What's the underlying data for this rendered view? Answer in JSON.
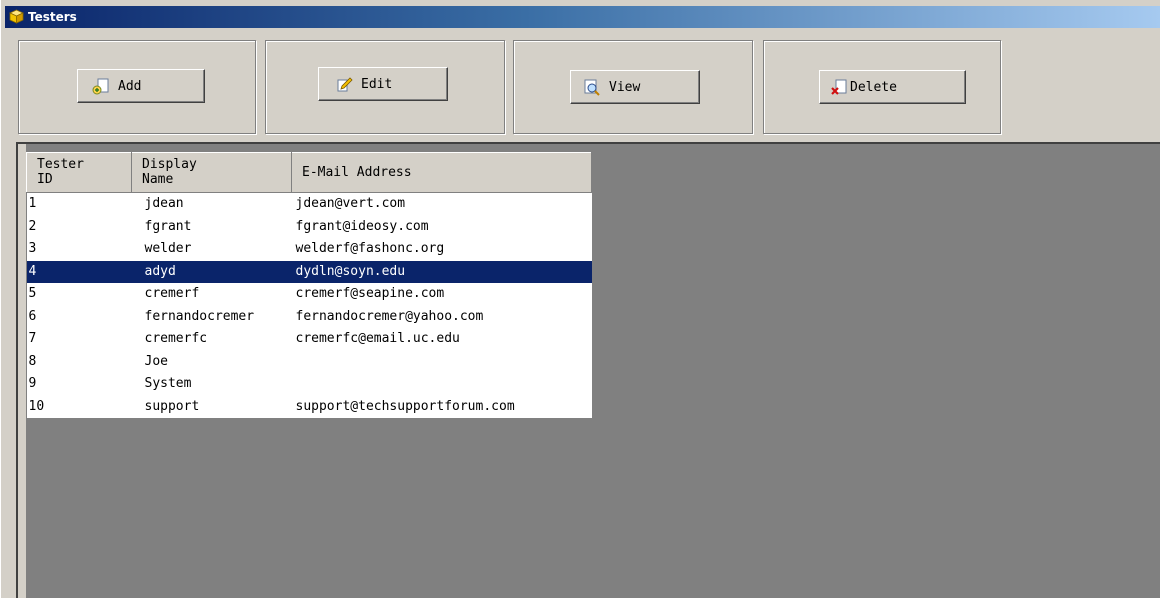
{
  "window": {
    "title": "Testers",
    "icon": "box-icon"
  },
  "toolbar": {
    "add_label": "Add",
    "edit_label": "Edit",
    "view_label": "View",
    "delete_label": "Delete"
  },
  "grid": {
    "columns": [
      {
        "line1": "Tester",
        "line2": "ID"
      },
      {
        "line1": "Display",
        "line2": "Name"
      },
      {
        "line1": "E-Mail Address",
        "line2": ""
      }
    ],
    "rows": [
      {
        "id": "1",
        "name": "jdean",
        "email": "jdean@vert.com"
      },
      {
        "id": "2",
        "name": "fgrant",
        "email": "fgrant@ideosy.com"
      },
      {
        "id": "3",
        "name": "welder",
        "email": "welderf@fashonc.org"
      },
      {
        "id": "4",
        "name": "adyd",
        "email": "dydln@soyn.edu"
      },
      {
        "id": "5",
        "name": "cremerf",
        "email": "cremerf@seapine.com"
      },
      {
        "id": "6",
        "name": "fernandocremer",
        "email": "fernandocremer@yahoo.com"
      },
      {
        "id": "7",
        "name": "cremerfc",
        "email": "cremerfc@email.uc.edu"
      },
      {
        "id": "8",
        "name": "Joe",
        "email": ""
      },
      {
        "id": "9",
        "name": "System",
        "email": ""
      },
      {
        "id": "10",
        "name": "support",
        "email": "support@techsupportforum.com"
      }
    ],
    "selected_id": "4"
  },
  "colors": {
    "selection": "#0a246a",
    "background": "#d4d0c8",
    "grid_empty": "#808080"
  }
}
